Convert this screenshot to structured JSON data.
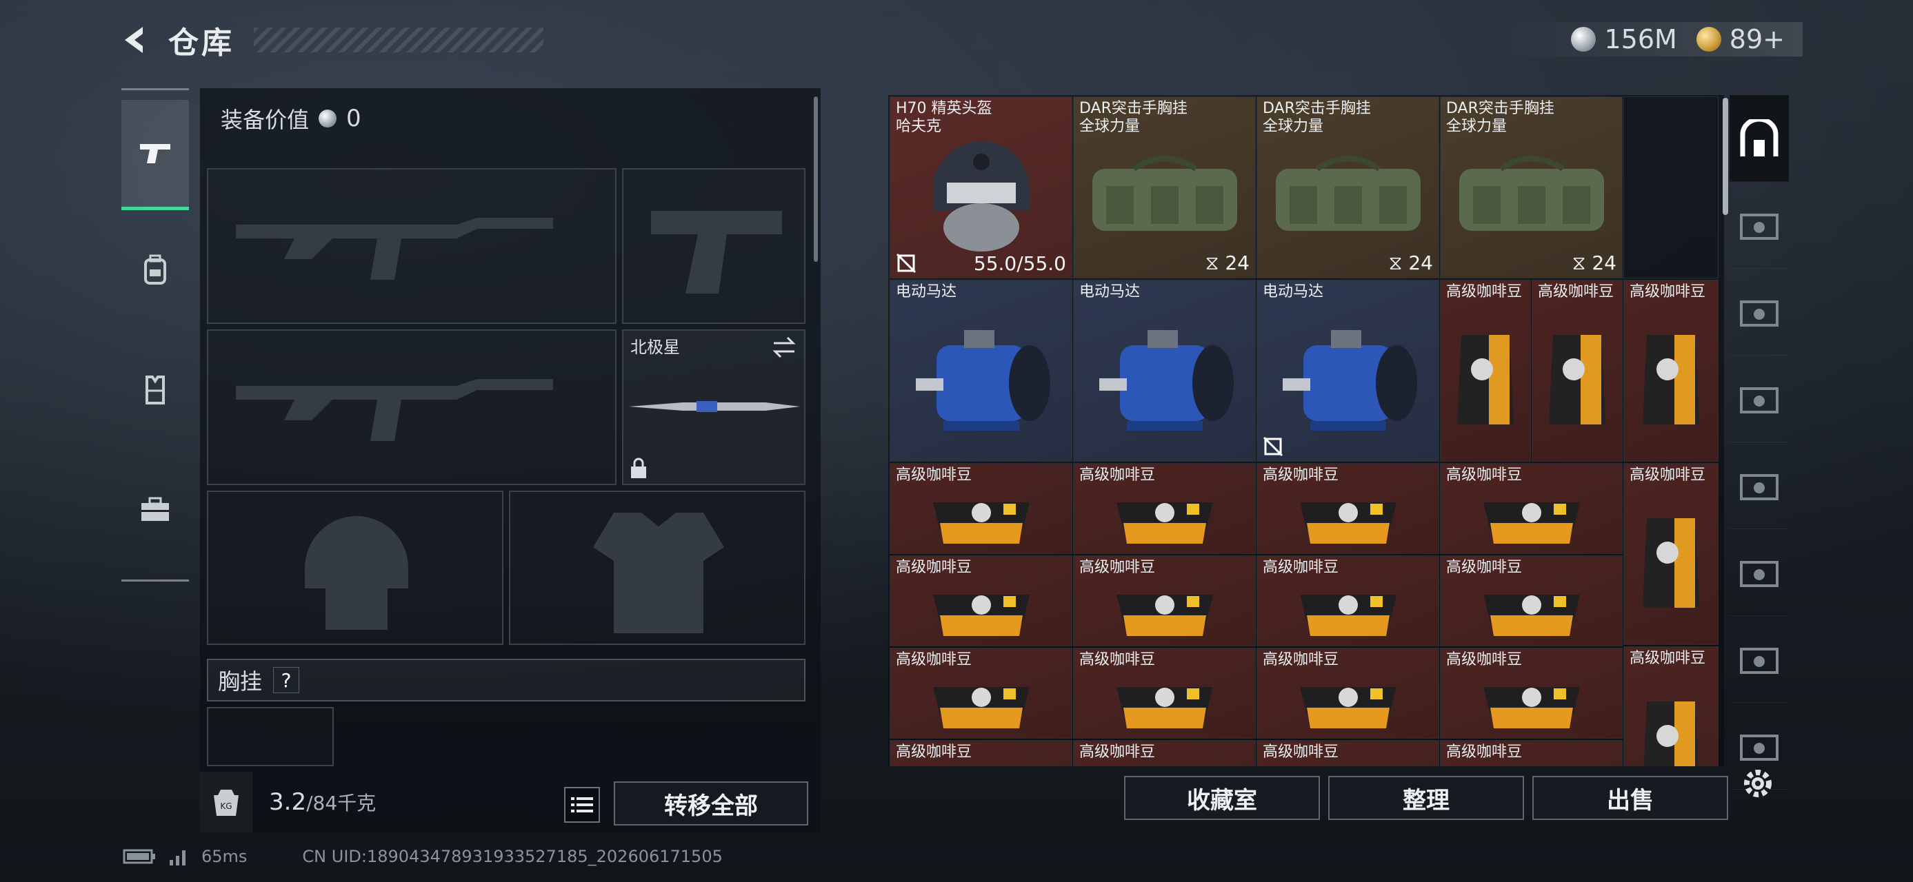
{
  "header": {
    "title": "仓库"
  },
  "currency": {
    "silver": "156M",
    "gold": "89+"
  },
  "equipment": {
    "value_label": "装备价值",
    "value": "0",
    "melee_label": "北极星",
    "chest_label": "胸挂",
    "chest_help": "?",
    "weight_current": "3.2",
    "weight_max": "/84千克",
    "transfer_all": "转移全部"
  },
  "stash": {
    "items": [
      {
        "name": "H70 精英头盔\n哈夫克",
        "foot": "55.0/55.0",
        "color": "red",
        "icon": "helmet"
      },
      {
        "name": "DAR突击手胸挂\n全球力量",
        "foot": "24",
        "color": "olive",
        "icon": "vest"
      },
      {
        "name": "DAR突击手胸挂\n全球力量",
        "foot": "24",
        "color": "olive",
        "icon": "vest"
      },
      {
        "name": "DAR突击手胸挂\n全球力量",
        "foot": "24",
        "color": "olive",
        "icon": "vest"
      },
      {
        "name": "电动马达",
        "color": "blue",
        "icon": "motor"
      },
      {
        "name": "电动马达",
        "color": "blue",
        "icon": "motor"
      },
      {
        "name": "电动马达",
        "color": "blue",
        "icon": "motor"
      },
      {
        "name": "高级咖啡豆",
        "color": "darkred",
        "icon": "coffee-bag"
      },
      {
        "name": "高级咖啡豆",
        "color": "darkred",
        "icon": "coffee-bag"
      },
      {
        "name": "高级咖啡豆",
        "color": "darkred",
        "icon": "coffee-bag"
      },
      {
        "name": "高级咖啡豆",
        "color": "darkred",
        "icon": "coffee-pack"
      }
    ],
    "coffee_label": "高级咖啡豆",
    "btn_collection": "收藏室",
    "btn_sort": "整理",
    "btn_sell": "出售"
  },
  "status": {
    "ping": "65ms",
    "uid": "CN UID:18904347893193352718​5_202606171505"
  },
  "colors": {
    "accent": "#3ddc9a",
    "rare_red": "#5b2b28",
    "olive": "#4a3d2c",
    "blue": "#2e3850"
  }
}
